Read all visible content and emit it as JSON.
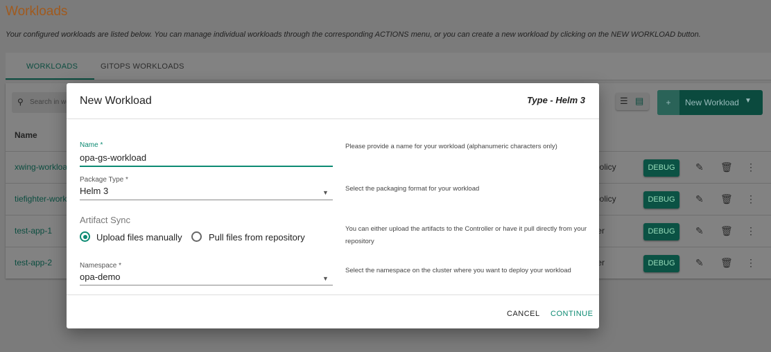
{
  "page": {
    "title": "Workloads",
    "subtitle": "Your configured workloads are listed below. You can manage individual workloads through the corresponding ACTIONS menu, or you can create a new workload by clicking on the NEW WORKLOAD button."
  },
  "tabs": [
    {
      "label": "WORKLOADS",
      "active": true
    },
    {
      "label": "GITOPS WORKLOADS",
      "active": false
    }
  ],
  "toolbar": {
    "search_placeholder": "Search in wo",
    "new_workload": "New Workload",
    "plus": "+"
  },
  "table": {
    "name_header": "Name",
    "debug_label": "DEBUG",
    "rows": [
      {
        "name": "xwing-workloa",
        "col": "policy"
      },
      {
        "name": "tiefighter-work",
        "col": "policy"
      },
      {
        "name": "test-app-1",
        "col": "ter"
      },
      {
        "name": "test-app-2",
        "col": "ter"
      }
    ]
  },
  "modal": {
    "title": "New Workload",
    "type": "Type - Helm 3",
    "name_label": "Name *",
    "name_value": "opa-gs-workload",
    "name_help": "Please provide a name for your workload (alphanumeric characters only)",
    "package_label": "Package Type *",
    "package_value": "Helm 3",
    "package_help": "Select the packaging format for your workload",
    "artifact_label": "Artifact Sync",
    "radio_upload": "Upload files manually",
    "radio_pull": "Pull files from repository",
    "artifact_selected": "Upload files manually",
    "artifact_help": "You can either upload the artifacts to the Controller or have it pull directly from your repository",
    "namespace_label": "Namespace *",
    "namespace_value": "opa-demo",
    "namespace_help": "Select the namespace on the cluster where you want to deploy your workload",
    "cancel": "CANCEL",
    "continue": "CONTINUE"
  },
  "colors": {
    "accent": "#0c8a72",
    "title": "#c8722a"
  }
}
